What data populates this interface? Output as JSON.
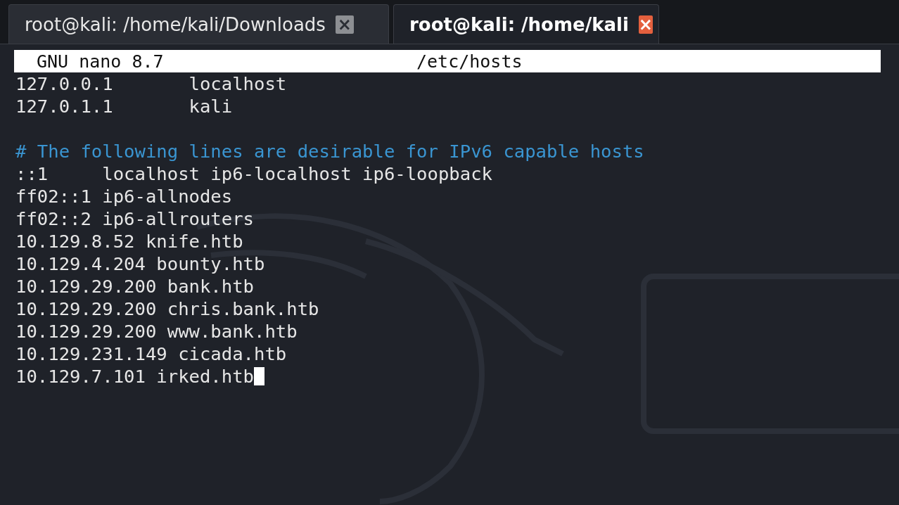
{
  "tabs": [
    {
      "title": "root@kali: /home/kali/Downloads",
      "selected": false,
      "close": "×"
    },
    {
      "title": "root@kali: /home/kali",
      "selected": true,
      "close": "×"
    }
  ],
  "editor": {
    "app": "GNU nano 8.7",
    "filename": "/etc/hosts"
  },
  "lines": [
    {
      "kind": "text",
      "text": "127.0.0.1       localhost",
      "cursor": false
    },
    {
      "kind": "text",
      "text": "127.0.1.1       kali",
      "cursor": false
    },
    {
      "kind": "blank"
    },
    {
      "kind": "comment",
      "text": "# The following lines are desirable for IPv6 capable hosts",
      "cursor": false
    },
    {
      "kind": "text",
      "text": "::1     localhost ip6-localhost ip6-loopback",
      "cursor": false
    },
    {
      "kind": "text",
      "text": "ff02::1 ip6-allnodes",
      "cursor": false
    },
    {
      "kind": "text",
      "text": "ff02::2 ip6-allrouters",
      "cursor": false
    },
    {
      "kind": "text",
      "text": "10.129.8.52 knife.htb",
      "cursor": false
    },
    {
      "kind": "text",
      "text": "10.129.4.204 bounty.htb",
      "cursor": false
    },
    {
      "kind": "text",
      "text": "10.129.29.200 bank.htb",
      "cursor": false
    },
    {
      "kind": "text",
      "text": "10.129.29.200 chris.bank.htb",
      "cursor": false
    },
    {
      "kind": "text",
      "text": "10.129.29.200 www.bank.htb",
      "cursor": false
    },
    {
      "kind": "text",
      "text": "10.129.231.149 cicada.htb",
      "cursor": false
    },
    {
      "kind": "text",
      "text": "10.129.7.101 irked.htb",
      "cursor": true
    }
  ]
}
